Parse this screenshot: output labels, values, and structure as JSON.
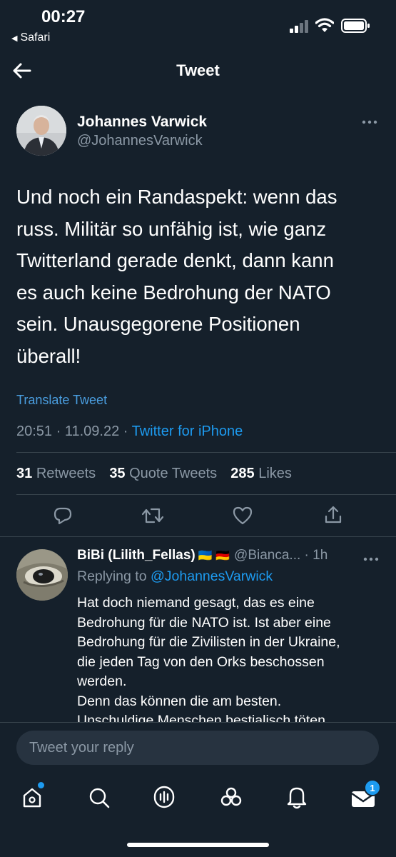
{
  "status": {
    "time": "00:27",
    "back_app": "Safari"
  },
  "header": {
    "title": "Tweet"
  },
  "tweet": {
    "author_name": "Johannes Varwick",
    "author_handle": "@JohannesVarwick",
    "text_lines": [
      "Und noch ein Randaspekt: wenn das",
      "russ. Militär so unfähig ist, wie ganz",
      "Twitterland gerade denkt, dann kann",
      "es auch keine Bedrohung der NATO",
      "sein. Unausgegorene Positionen",
      "überall!"
    ],
    "translate": "Translate Tweet",
    "datetime": "20:51 · 11.09.22 · ",
    "source": "Twitter for iPhone",
    "retweets_count": "31",
    "retweets_label": "Retweets",
    "quotes_count": "35",
    "quotes_label": "Quote Tweets",
    "likes_count": "285",
    "likes_label": "Likes"
  },
  "reply": {
    "author_name": "BiBi (Lilith_Fellas)",
    "flags": "🇺🇦 🇩🇪",
    "handle_time": "@Bianca... · 1h",
    "replying_prefix": "Replying to ",
    "replying_to": "@JohannesVarwick",
    "text_lines": [
      "Hat doch niemand gesagt, das es eine",
      "Bedrohung für die NATO ist. Ist aber eine",
      "Bedrohung für die Zivilisten in der Ukraine,",
      "die jeden Tag von den Orks beschossen",
      "werden.",
      "Denn das können die am besten.",
      "Unschuldige Menschen bestialisch töten"
    ]
  },
  "composer": {
    "placeholder": "Tweet your reply"
  },
  "tabbar": {
    "messages_badge": "1"
  },
  "colors": {
    "background": "#15202b",
    "accent": "#1d9bf0",
    "muted": "#8b98a5",
    "divider": "#38444d"
  }
}
